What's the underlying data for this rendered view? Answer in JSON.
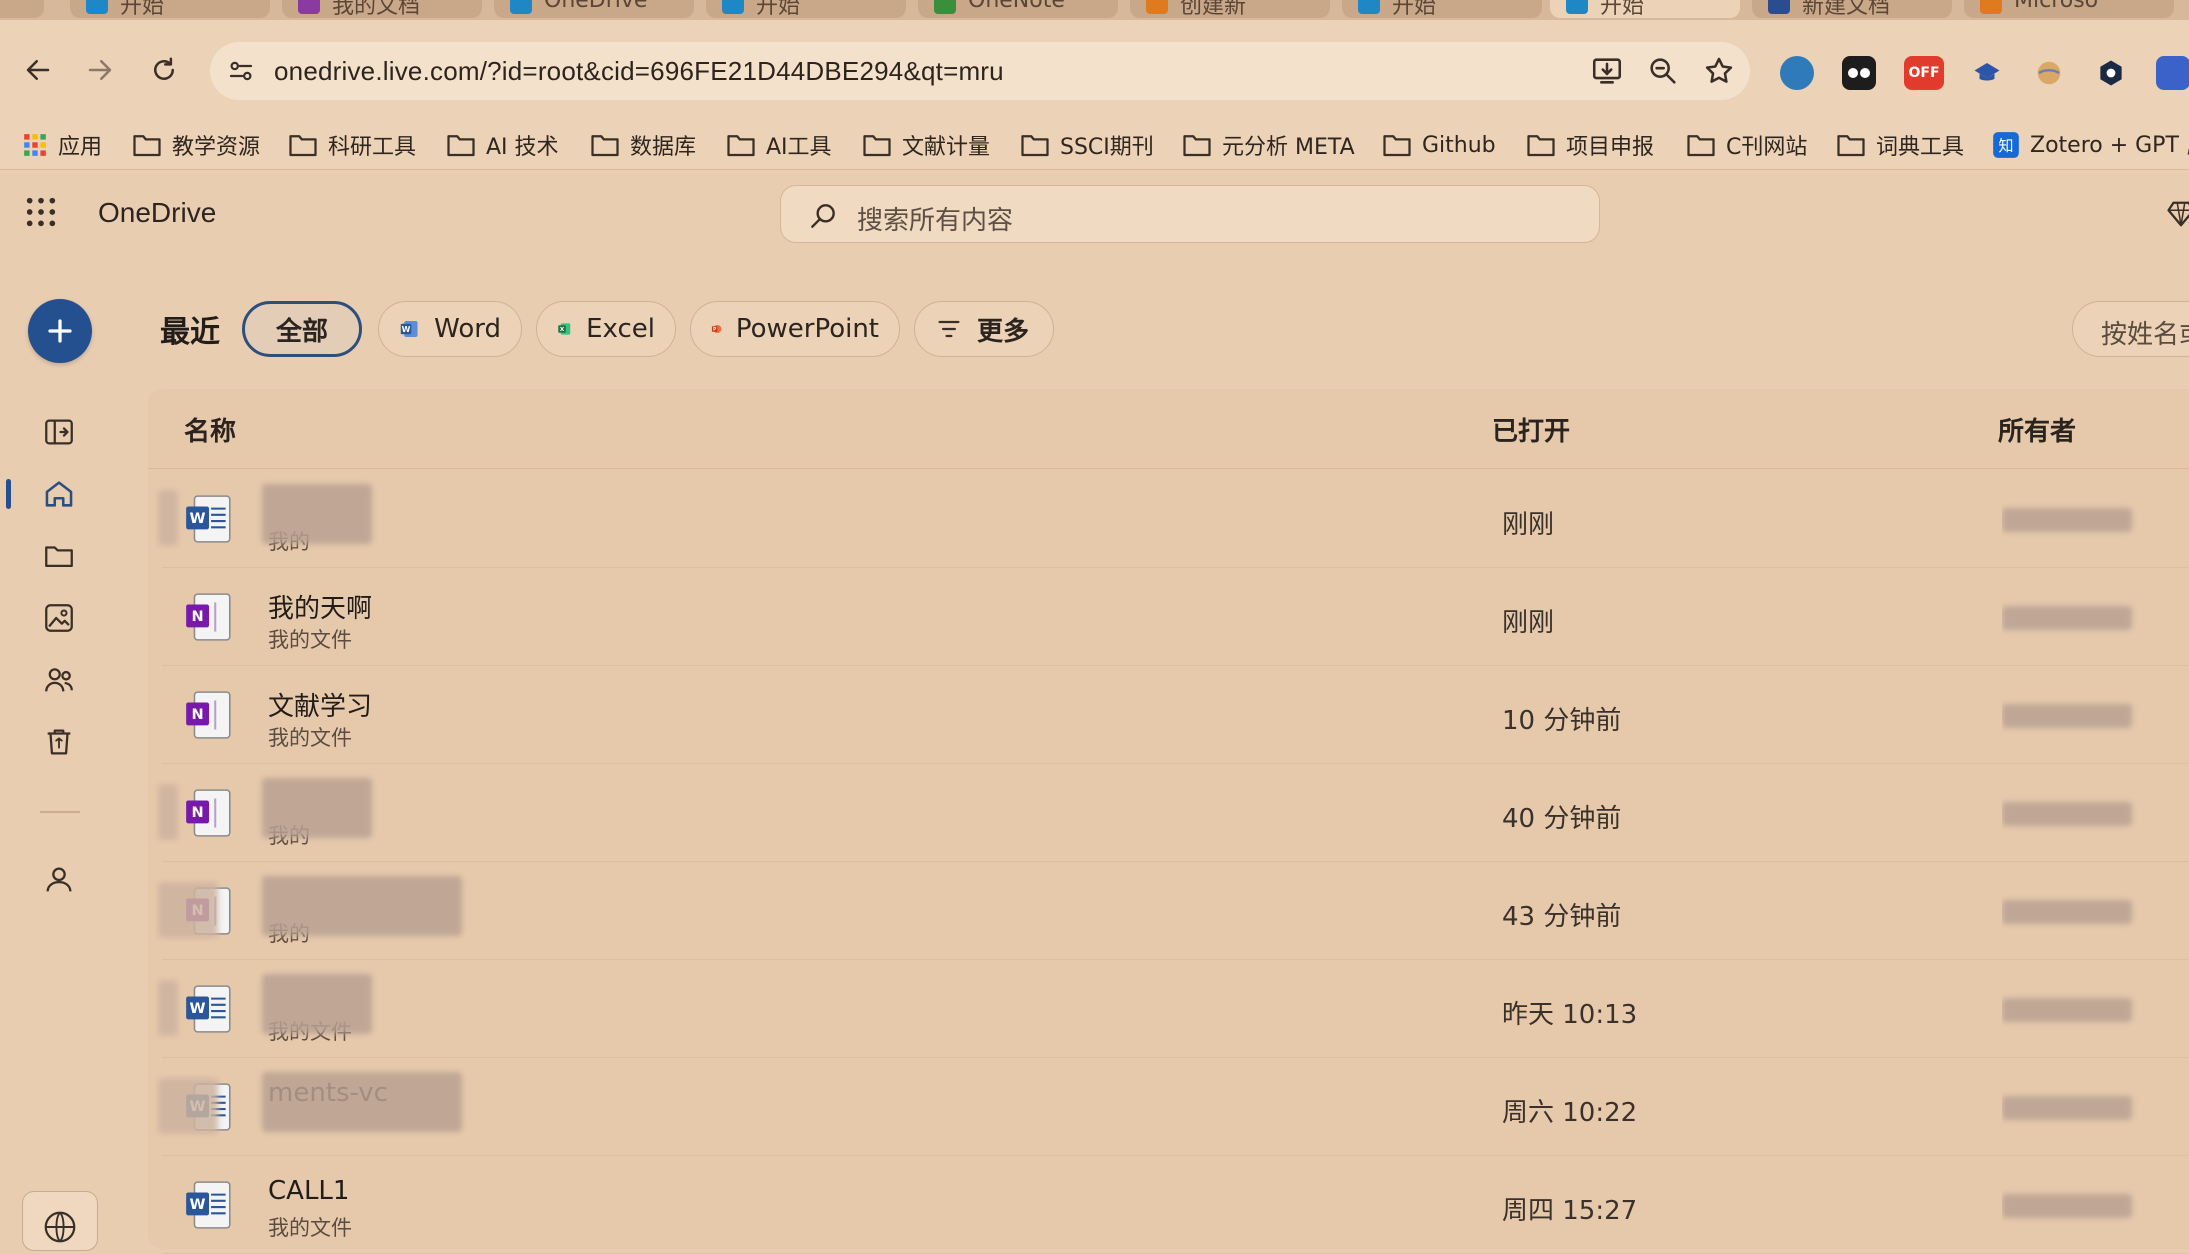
{
  "browser": {
    "tabs": [
      {
        "label": "开始",
        "favicon_color": "#1e88c7"
      },
      {
        "label": "我的文档",
        "favicon_color": "#8a3aa0"
      },
      {
        "label": "OneDrive",
        "favicon_color": "#1e88c7"
      },
      {
        "label": "开始",
        "favicon_color": "#1e88c7"
      },
      {
        "label": "OneNote",
        "favicon_color": "#3a8f3a"
      },
      {
        "label": "创建新",
        "favicon_color": "#e07a1f"
      },
      {
        "label": "开始",
        "favicon_color": "#1e88c7"
      },
      {
        "label": "开始",
        "favicon_color": "#1e88c7"
      },
      {
        "label": "新建文档",
        "favicon_color": "#2a4d8f"
      },
      {
        "label": "Microso",
        "favicon_color": "#e07a1f"
      }
    ],
    "url": "onedrive.live.com/?id=root&cid=696FE21D44DBE294&qt=mru",
    "extension_badge": "OFF",
    "bookmarks": [
      "应用",
      "教学资源",
      "科研工具",
      "AI 技术",
      "数据库",
      "AI工具",
      "文献计量",
      "SSCI期刊",
      "元分析 META",
      "Github",
      "项目申报",
      "C刊网站",
      "词典工具",
      "Zotero + GPT ,"
    ]
  },
  "app": {
    "brand": "OneDrive",
    "search_placeholder": "搜索所有内容",
    "section_title": "最近",
    "filters": {
      "all": "全部",
      "word": "Word",
      "excel": "Excel",
      "powerpoint": "PowerPoint",
      "more": "更多"
    },
    "sort_label": "按姓名或",
    "columns": {
      "name": "名称",
      "opened": "已打开",
      "owner": "所有者"
    },
    "colors": {
      "accent": "#24508f",
      "word": "#2b579a",
      "onenote": "#7719aa",
      "excel": "#217346",
      "powerpoint": "#c43e1c"
    },
    "files": [
      {
        "type": "word",
        "name": "",
        "location": "我的",
        "opened": "刚刚",
        "redacted": true
      },
      {
        "type": "onenote",
        "name": "我的天啊",
        "location": "我的文件",
        "opened": "刚刚",
        "redacted": false
      },
      {
        "type": "onenote",
        "name": "文献学习",
        "location": "我的文件",
        "opened": "10 分钟前",
        "redacted": false
      },
      {
        "type": "onenote",
        "name": "",
        "location": "我的",
        "opened": "40 分钟前",
        "redacted": true
      },
      {
        "type": "onenote",
        "name": "",
        "location": "我的",
        "opened": "43 分钟前",
        "redacted": true
      },
      {
        "type": "word",
        "name": "",
        "location": "我的文件",
        "opened": "昨天 10:13",
        "redacted": true
      },
      {
        "type": "word",
        "name": "ments-vc",
        "location": "",
        "opened": "周六 10:22",
        "redacted": true
      },
      {
        "type": "word",
        "name": "CALL1",
        "location": "我的文件",
        "opened": "周四 15:27",
        "redacted": false
      }
    ]
  }
}
